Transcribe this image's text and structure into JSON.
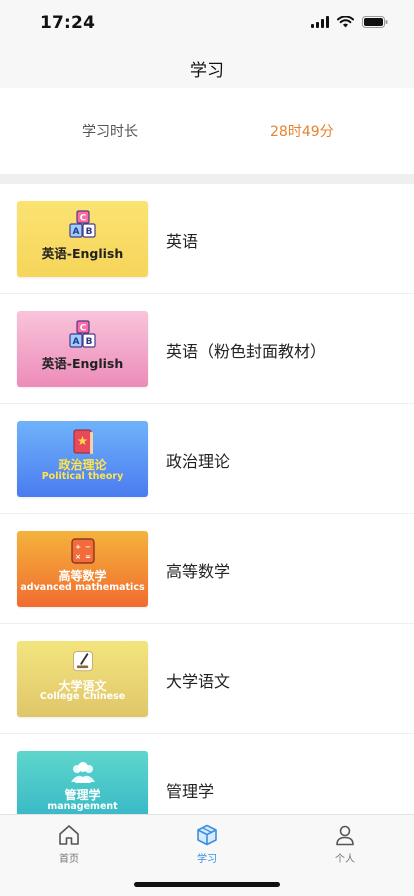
{
  "status_bar": {
    "time": "17:24"
  },
  "nav": {
    "title": "学习"
  },
  "study_time": {
    "label": "学习时长",
    "value": "28时49分",
    "value_color": "#e8822d"
  },
  "courses": [
    {
      "name": "英语",
      "cover_cn": "英语-English",
      "cover_en": "",
      "icon": "abc-blocks-icon",
      "theme": "yellow"
    },
    {
      "name": "英语（粉色封面教材）",
      "cover_cn": "英语-English",
      "cover_en": "",
      "icon": "abc-blocks-icon",
      "theme": "pink"
    },
    {
      "name": "政治理论",
      "cover_cn": "政治理论",
      "cover_en": "Political theory",
      "icon": "red-book-icon",
      "theme": "blue"
    },
    {
      "name": "高等数学",
      "cover_cn": "高等数学",
      "cover_en": "advanced mathematics",
      "icon": "calculator-icon",
      "theme": "orange"
    },
    {
      "name": "大学语文",
      "cover_cn": "大学语文",
      "cover_en": "College Chinese",
      "icon": "writing-icon",
      "theme": "khaki"
    },
    {
      "name": "管理学",
      "cover_cn": "管理学",
      "cover_en": "management",
      "icon": "people-icon",
      "theme": "teal"
    }
  ],
  "tabs": [
    {
      "label": "首页",
      "icon": "home-icon",
      "active": false
    },
    {
      "label": "学习",
      "icon": "cube-icon",
      "active": true
    },
    {
      "label": "个人",
      "icon": "person-icon",
      "active": false
    }
  ],
  "colors": {
    "accent": "#3a8fe0",
    "orange": "#e8822d"
  }
}
